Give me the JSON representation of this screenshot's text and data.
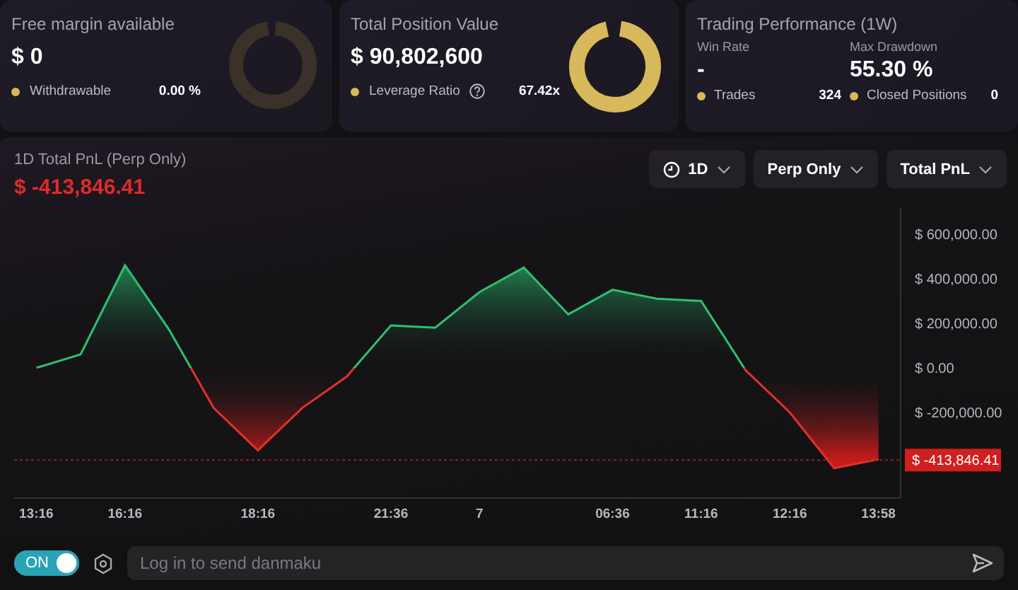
{
  "cards": {
    "free_margin": {
      "title": "Free margin available",
      "value": "$ 0",
      "legend": {
        "label": "Withdrawable",
        "value": "0.00 %"
      }
    },
    "position_value": {
      "title": "Total Position Value",
      "value": "$ 90,802,600",
      "legend": {
        "label": "Leverage Ratio",
        "value": "67.42x"
      }
    },
    "performance": {
      "title": "Trading Performance (1W)",
      "stats": [
        {
          "label": "Win Rate",
          "value": "-"
        },
        {
          "label": "Max Drawdown",
          "value": "55.30 %"
        }
      ],
      "legend": [
        {
          "label": "Trades",
          "value": "324"
        },
        {
          "label": "Closed Positions",
          "value": "0"
        }
      ]
    }
  },
  "pnl": {
    "title": "1D Total PnL (Perp Only)",
    "value": "$ -413,846.41",
    "filters": [
      {
        "kind": "period",
        "label": "1D"
      },
      {
        "kind": "plain",
        "label": "Perp Only"
      },
      {
        "kind": "plain",
        "label": "Total PnL"
      }
    ],
    "chart_data": {
      "type": "area",
      "categories": [
        "13:16",
        null,
        "16:16",
        null,
        null,
        "18:16",
        null,
        null,
        "21:36",
        null,
        "7",
        null,
        null,
        "06:36",
        null,
        "11:16",
        null,
        "12:16",
        null,
        "13:58"
      ],
      "values": [
        0,
        60000,
        460000,
        170000,
        -180000,
        -370000,
        -180000,
        -40000,
        190000,
        180000,
        340000,
        450000,
        240000,
        350000,
        310000,
        300000,
        -10000,
        -200000,
        -450000,
        -410000
      ],
      "ref_lines": [
        {
          "axis": "y",
          "value": -413846.41,
          "label": "$ -413,846.41"
        }
      ],
      "ylim": [
        -584000,
        717000
      ],
      "yticks": [
        {
          "value": 600000,
          "label": "$ 600,000.00"
        },
        {
          "value": 400000,
          "label": "$ 400,000.00"
        },
        {
          "value": 200000,
          "label": "$ 200,000.00"
        },
        {
          "value": 0,
          "label": "$ 0.00"
        },
        {
          "value": -200000,
          "label": "$ -200,000.00"
        }
      ]
    }
  },
  "danmaku": {
    "toggle": {
      "label": "ON",
      "on": true
    },
    "placeholder": "Log in to send danmaku"
  }
}
